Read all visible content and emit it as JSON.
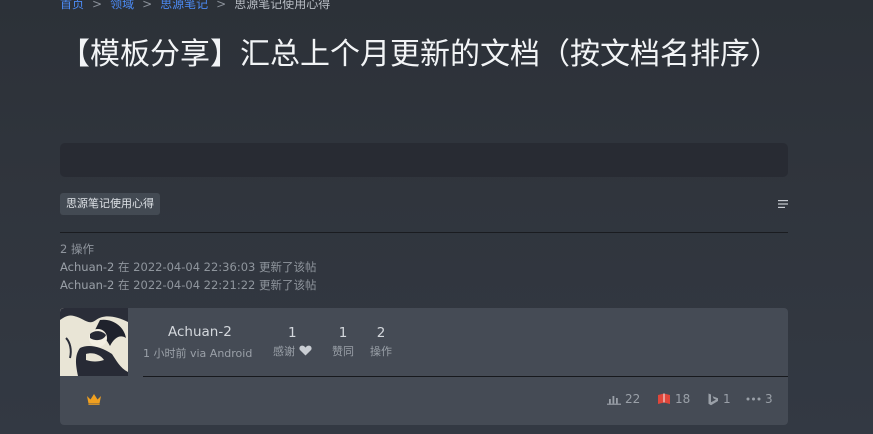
{
  "breadcrumb": {
    "items": [
      "首页",
      "领域",
      "思源笔记",
      "思源笔记使用心得"
    ],
    "separator": ">"
  },
  "title": "【模板分享】汇总上个月更新的文档（按文档名排序）",
  "tag": "思源笔记使用心得",
  "operations": {
    "count_label": "2 操作",
    "entries": [
      {
        "user": "Achuan-2",
        "text": " 在 2022-04-04 22:36:03 更新了该帖"
      },
      {
        "user": "Achuan-2",
        "text": " 在 2022-04-04 22:21:22 更新了该帖"
      }
    ]
  },
  "post": {
    "author": "Achuan-2",
    "meta": "1 小时前 via Android",
    "stats": [
      {
        "num": "1",
        "label": "感谢"
      },
      {
        "num": "1",
        "label": "赞同"
      },
      {
        "num": "2",
        "label": "操作"
      }
    ],
    "footer": {
      "views": "22",
      "likes": "18",
      "bing": "1",
      "more": "3"
    }
  },
  "colors": {
    "accent_link": "#4c8bf5",
    "crown": "#f0a020",
    "likes_icon": "#e0463a"
  }
}
